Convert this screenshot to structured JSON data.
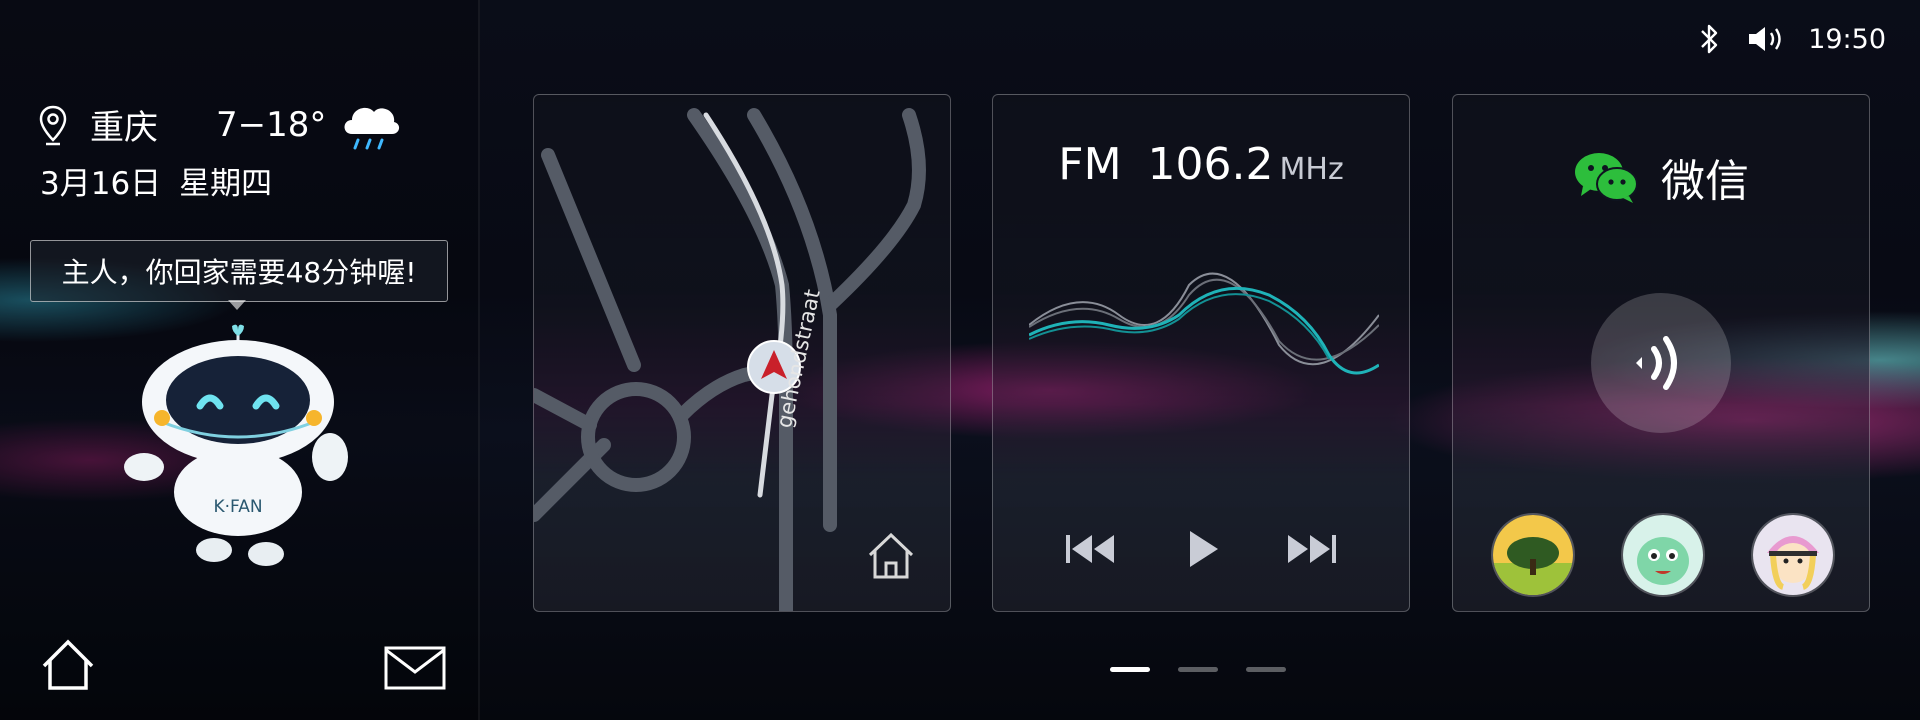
{
  "status_bar": {
    "time": "19:50",
    "bluetooth_icon": "bluetooth-icon",
    "volume_icon": "volume-icon"
  },
  "weather": {
    "city": "重庆",
    "temperature": "7−18°",
    "date": "3月16日",
    "weekday": "星期四",
    "condition_icon": "rain-cloud-icon"
  },
  "assistant": {
    "message": "主人，你回家需要48分钟喔!",
    "mascot_text": "K·FAN"
  },
  "navigation_card": {
    "street_name": "gehondstraat"
  },
  "radio_card": {
    "band": "FM",
    "frequency": "106.2",
    "unit": "MHz"
  },
  "wechat_card": {
    "title": "微信",
    "contacts": [
      "avatar-tree",
      "avatar-dragon",
      "avatar-girl"
    ]
  },
  "pager": {
    "pages": 3,
    "active": 0
  }
}
